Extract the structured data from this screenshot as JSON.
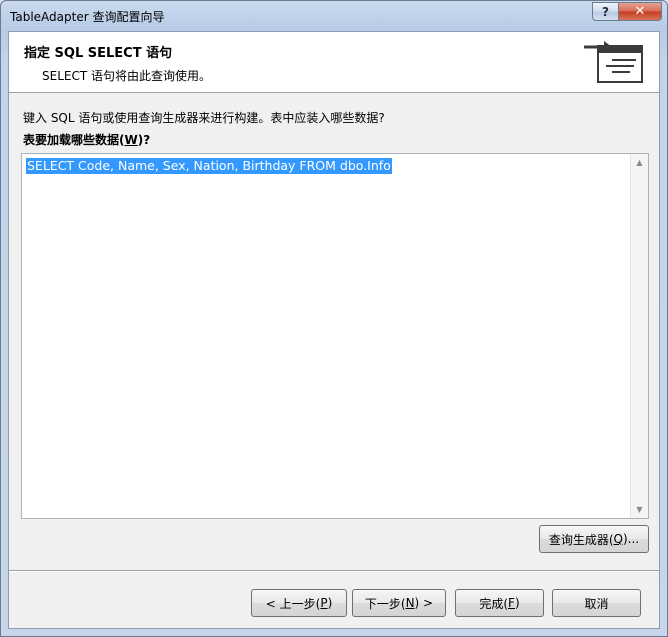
{
  "window": {
    "title": "TableAdapter 查询配置向导",
    "help_label": "?",
    "close_label": "✕"
  },
  "header": {
    "title": "指定 SQL  SELECT 语句",
    "subtitle": "SELECT 语句将由此查询使用。",
    "icon": "query-wizard-icon"
  },
  "content": {
    "instruction": "键入 SQL 语句或使用查询生成器来进行构建。表中应装入哪些数据?",
    "field_label_prefix": "表要加载哪些数据(",
    "field_label_key": "W",
    "field_label_suffix": ")?",
    "sql_value": "SELECT Code, Name, Sex, Nation, Birthday FROM dbo.Info",
    "query_builder_prefix": "查询生成器(",
    "query_builder_key": "Q",
    "query_builder_suffix": ")..."
  },
  "footer": {
    "back_prefix": "< 上一步(",
    "back_key": "P",
    "back_suffix": ")",
    "next_prefix": "下一步(",
    "next_key": "N",
    "next_suffix": ") >",
    "finish_prefix": "完成(",
    "finish_key": "F",
    "finish_suffix": ")",
    "cancel_label": "取消"
  },
  "colors": {
    "selection": "#3399ff",
    "header_bg": "#ffffff",
    "body_bg": "#f0f0f0"
  }
}
